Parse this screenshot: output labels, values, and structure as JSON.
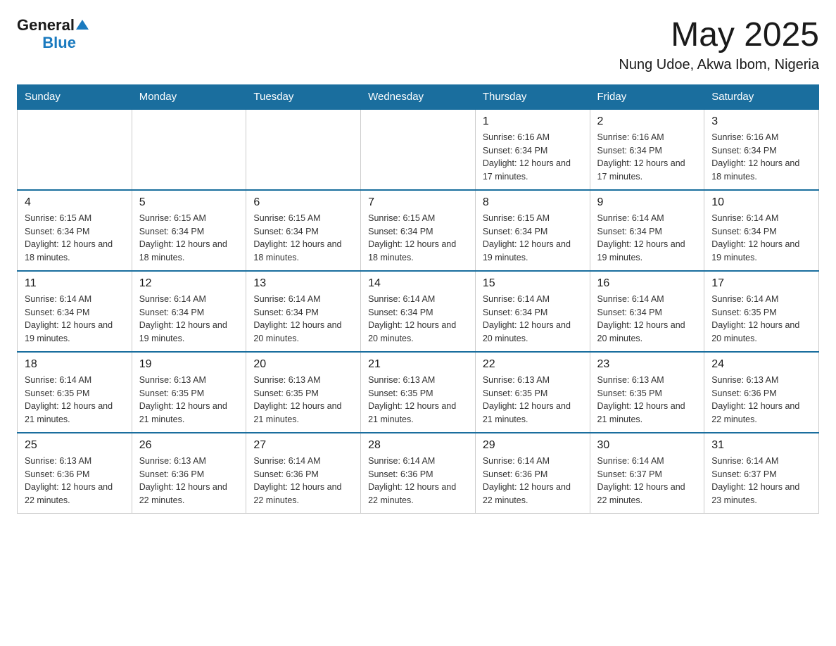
{
  "header": {
    "logo_general": "General",
    "logo_blue": "Blue",
    "month_title": "May 2025",
    "location": "Nung Udoe, Akwa Ibom, Nigeria"
  },
  "days_of_week": [
    "Sunday",
    "Monday",
    "Tuesday",
    "Wednesday",
    "Thursday",
    "Friday",
    "Saturday"
  ],
  "weeks": [
    {
      "days": [
        {
          "number": "",
          "info": ""
        },
        {
          "number": "",
          "info": ""
        },
        {
          "number": "",
          "info": ""
        },
        {
          "number": "",
          "info": ""
        },
        {
          "number": "1",
          "info": "Sunrise: 6:16 AM\nSunset: 6:34 PM\nDaylight: 12 hours and 17 minutes."
        },
        {
          "number": "2",
          "info": "Sunrise: 6:16 AM\nSunset: 6:34 PM\nDaylight: 12 hours and 17 minutes."
        },
        {
          "number": "3",
          "info": "Sunrise: 6:16 AM\nSunset: 6:34 PM\nDaylight: 12 hours and 18 minutes."
        }
      ]
    },
    {
      "days": [
        {
          "number": "4",
          "info": "Sunrise: 6:15 AM\nSunset: 6:34 PM\nDaylight: 12 hours and 18 minutes."
        },
        {
          "number": "5",
          "info": "Sunrise: 6:15 AM\nSunset: 6:34 PM\nDaylight: 12 hours and 18 minutes."
        },
        {
          "number": "6",
          "info": "Sunrise: 6:15 AM\nSunset: 6:34 PM\nDaylight: 12 hours and 18 minutes."
        },
        {
          "number": "7",
          "info": "Sunrise: 6:15 AM\nSunset: 6:34 PM\nDaylight: 12 hours and 18 minutes."
        },
        {
          "number": "8",
          "info": "Sunrise: 6:15 AM\nSunset: 6:34 PM\nDaylight: 12 hours and 19 minutes."
        },
        {
          "number": "9",
          "info": "Sunrise: 6:14 AM\nSunset: 6:34 PM\nDaylight: 12 hours and 19 minutes."
        },
        {
          "number": "10",
          "info": "Sunrise: 6:14 AM\nSunset: 6:34 PM\nDaylight: 12 hours and 19 minutes."
        }
      ]
    },
    {
      "days": [
        {
          "number": "11",
          "info": "Sunrise: 6:14 AM\nSunset: 6:34 PM\nDaylight: 12 hours and 19 minutes."
        },
        {
          "number": "12",
          "info": "Sunrise: 6:14 AM\nSunset: 6:34 PM\nDaylight: 12 hours and 19 minutes."
        },
        {
          "number": "13",
          "info": "Sunrise: 6:14 AM\nSunset: 6:34 PM\nDaylight: 12 hours and 20 minutes."
        },
        {
          "number": "14",
          "info": "Sunrise: 6:14 AM\nSunset: 6:34 PM\nDaylight: 12 hours and 20 minutes."
        },
        {
          "number": "15",
          "info": "Sunrise: 6:14 AM\nSunset: 6:34 PM\nDaylight: 12 hours and 20 minutes."
        },
        {
          "number": "16",
          "info": "Sunrise: 6:14 AM\nSunset: 6:34 PM\nDaylight: 12 hours and 20 minutes."
        },
        {
          "number": "17",
          "info": "Sunrise: 6:14 AM\nSunset: 6:35 PM\nDaylight: 12 hours and 20 minutes."
        }
      ]
    },
    {
      "days": [
        {
          "number": "18",
          "info": "Sunrise: 6:14 AM\nSunset: 6:35 PM\nDaylight: 12 hours and 21 minutes."
        },
        {
          "number": "19",
          "info": "Sunrise: 6:13 AM\nSunset: 6:35 PM\nDaylight: 12 hours and 21 minutes."
        },
        {
          "number": "20",
          "info": "Sunrise: 6:13 AM\nSunset: 6:35 PM\nDaylight: 12 hours and 21 minutes."
        },
        {
          "number": "21",
          "info": "Sunrise: 6:13 AM\nSunset: 6:35 PM\nDaylight: 12 hours and 21 minutes."
        },
        {
          "number": "22",
          "info": "Sunrise: 6:13 AM\nSunset: 6:35 PM\nDaylight: 12 hours and 21 minutes."
        },
        {
          "number": "23",
          "info": "Sunrise: 6:13 AM\nSunset: 6:35 PM\nDaylight: 12 hours and 21 minutes."
        },
        {
          "number": "24",
          "info": "Sunrise: 6:13 AM\nSunset: 6:36 PM\nDaylight: 12 hours and 22 minutes."
        }
      ]
    },
    {
      "days": [
        {
          "number": "25",
          "info": "Sunrise: 6:13 AM\nSunset: 6:36 PM\nDaylight: 12 hours and 22 minutes."
        },
        {
          "number": "26",
          "info": "Sunrise: 6:13 AM\nSunset: 6:36 PM\nDaylight: 12 hours and 22 minutes."
        },
        {
          "number": "27",
          "info": "Sunrise: 6:14 AM\nSunset: 6:36 PM\nDaylight: 12 hours and 22 minutes."
        },
        {
          "number": "28",
          "info": "Sunrise: 6:14 AM\nSunset: 6:36 PM\nDaylight: 12 hours and 22 minutes."
        },
        {
          "number": "29",
          "info": "Sunrise: 6:14 AM\nSunset: 6:36 PM\nDaylight: 12 hours and 22 minutes."
        },
        {
          "number": "30",
          "info": "Sunrise: 6:14 AM\nSunset: 6:37 PM\nDaylight: 12 hours and 22 minutes."
        },
        {
          "number": "31",
          "info": "Sunrise: 6:14 AM\nSunset: 6:37 PM\nDaylight: 12 hours and 23 minutes."
        }
      ]
    }
  ]
}
